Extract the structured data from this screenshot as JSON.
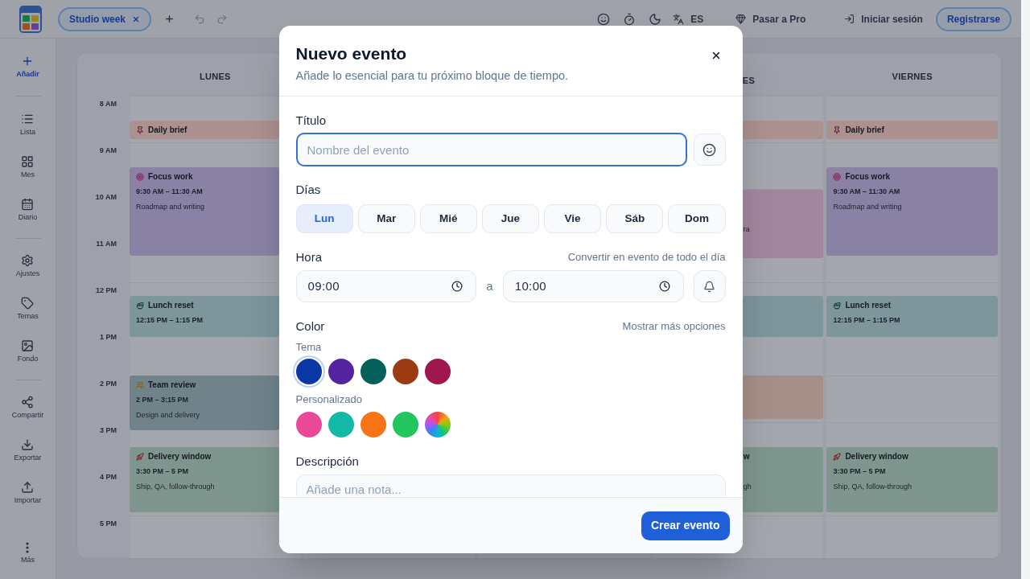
{
  "top_bar": {
    "tab": {
      "label": "Studio week"
    },
    "language": "ES",
    "upgrade": "Pasar a Pro",
    "login": "Iniciar sesión",
    "signup": "Registrarse"
  },
  "sidebar": {
    "add": "Añadir",
    "groups": [
      [
        "Lista",
        "Mes",
        "Diario"
      ],
      [
        "Ajustes",
        "Temas",
        "Fondo"
      ],
      [
        "Compartir",
        "Exportar",
        "Importar"
      ]
    ],
    "more": "Más"
  },
  "calendar": {
    "hours": [
      "8 AM",
      "9 AM",
      "10 AM",
      "11 AM",
      "12 PM",
      "1 PM",
      "2 PM",
      "3 PM",
      "4 PM",
      "5 PM"
    ],
    "days": [
      {
        "name": "LUNES",
        "kind": "full",
        "events": [
          {
            "kind": "brief",
            "title": "Daily brief",
            "color": "#ab9190"
          },
          {
            "kind": "focus",
            "title": "Focus work",
            "time": "9:30 AM – 11:30 AM",
            "note": "Roadmap and writing",
            "color": "#8a82a5"
          },
          {
            "kind": "lunch",
            "title": "Lunch reset",
            "time": "12:15 PM – 1:15 PM",
            "color": "#7c969c"
          },
          {
            "kind": "review",
            "title": "Team review",
            "time": "2 PM – 3:15 PM",
            "note": "Design and delivery",
            "color": "#70838b"
          },
          {
            "kind": "delivery",
            "title": "Delivery window",
            "time": "3:30 PM – 5 PM",
            "note": "Ship, QA, follow-through",
            "color": "#7e968e"
          }
        ]
      },
      {
        "name": "ES",
        "kind": "partial",
        "events": [
          {
            "color": "#ab9190"
          },
          {
            "note": "ra",
            "color": "#a2869e"
          },
          {
            "color": "#7c969c"
          },
          {
            "color": "#a68f88"
          },
          {
            "title": "w",
            "note": "gh",
            "color": "#7e968e"
          }
        ]
      },
      {
        "name": "VIERNES",
        "kind": "full",
        "events": [
          {
            "kind": "brief",
            "title": "Daily brief",
            "color": "#ab9190"
          },
          {
            "kind": "focus",
            "title": "Focus work",
            "time": "9:30 AM – 11:30 AM",
            "note": "Roadmap and writing",
            "color": "#8a82a5"
          },
          {
            "kind": "lunch",
            "title": "Lunch reset",
            "time": "12:15 PM – 1:15 PM",
            "color": "#7c969c"
          },
          {
            "kind": "delivery",
            "title": "Delivery window",
            "time": "3:30 PM – 5 PM",
            "note": "Ship, QA, follow-through",
            "color": "#7e968e"
          }
        ]
      }
    ]
  },
  "dialog": {
    "title": "Nuevo evento",
    "subtitle": "Añade lo esencial para tu próximo bloque de tiempo.",
    "title_field": {
      "label": "Título",
      "placeholder": "Nombre del evento",
      "focused": true
    },
    "days": {
      "label": "Días",
      "options": [
        {
          "label": "Lun",
          "selected": true
        },
        {
          "label": "Mar",
          "selected": false
        },
        {
          "label": "Mié",
          "selected": false
        },
        {
          "label": "Jue",
          "selected": false
        },
        {
          "label": "Vie",
          "selected": false
        },
        {
          "label": "Sáb",
          "selected": false
        },
        {
          "label": "Dom",
          "selected": false
        }
      ]
    },
    "time": {
      "label": "Hora",
      "link": "Convertir en evento de todo el día",
      "start": "09:00",
      "separator": "a",
      "end": "10:00"
    },
    "color": {
      "label": "Color",
      "link": "Mostrar más opciones",
      "theme_label": "Tema",
      "theme": [
        {
          "kind": "solid",
          "color": "#0a37a6",
          "selected": true
        },
        {
          "kind": "solid",
          "color": "#5522a0",
          "selected": false
        },
        {
          "kind": "solid",
          "color": "#04605a",
          "selected": false
        },
        {
          "kind": "solid",
          "color": "#9c3a12",
          "selected": false
        },
        {
          "kind": "solid",
          "color": "#9f174d",
          "selected": false
        }
      ],
      "custom_label": "Personalizado",
      "custom": [
        {
          "kind": "solid",
          "color": "#ec4899",
          "selected": false
        },
        {
          "kind": "solid",
          "color": "#14b8a6",
          "selected": false
        },
        {
          "kind": "solid",
          "color": "#f97316",
          "selected": false
        },
        {
          "kind": "solid",
          "color": "#22c55e",
          "selected": false
        },
        {
          "kind": "spectrum",
          "selected": false
        }
      ]
    },
    "description": {
      "label": "Descripción",
      "placeholder": "Añade una nota..."
    },
    "submit": "Crear evento"
  }
}
